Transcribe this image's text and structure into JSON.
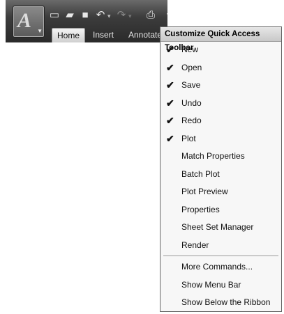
{
  "qat": {
    "app_icon": "autocad-a-logo",
    "icons": [
      "new-icon",
      "open-icon",
      "save-icon",
      "undo-icon",
      "redo-icon",
      "plot-icon"
    ],
    "dropdown_icon": "chevron-down-icon"
  },
  "tabs": [
    "Home",
    "Insert",
    "Annotate"
  ],
  "menu": {
    "title": "Customize Quick Access Toolbar",
    "items": [
      {
        "label": "New",
        "checked": true
      },
      {
        "label": "Open",
        "checked": true
      },
      {
        "label": "Save",
        "checked": true
      },
      {
        "label": "Undo",
        "checked": true
      },
      {
        "label": "Redo",
        "checked": true
      },
      {
        "label": "Plot",
        "checked": true
      },
      {
        "label": "Match Properties",
        "checked": false
      },
      {
        "label": "Batch Plot",
        "checked": false
      },
      {
        "label": "Plot Preview",
        "checked": false
      },
      {
        "label": "Properties",
        "checked": false
      },
      {
        "label": "Sheet Set Manager",
        "checked": false
      },
      {
        "label": "Render",
        "checked": false
      }
    ],
    "extra_items": [
      {
        "label": "More Commands..."
      },
      {
        "label": "Show Menu Bar"
      },
      {
        "label": "Show Below the Ribbon"
      }
    ],
    "check_glyph": "✔"
  }
}
